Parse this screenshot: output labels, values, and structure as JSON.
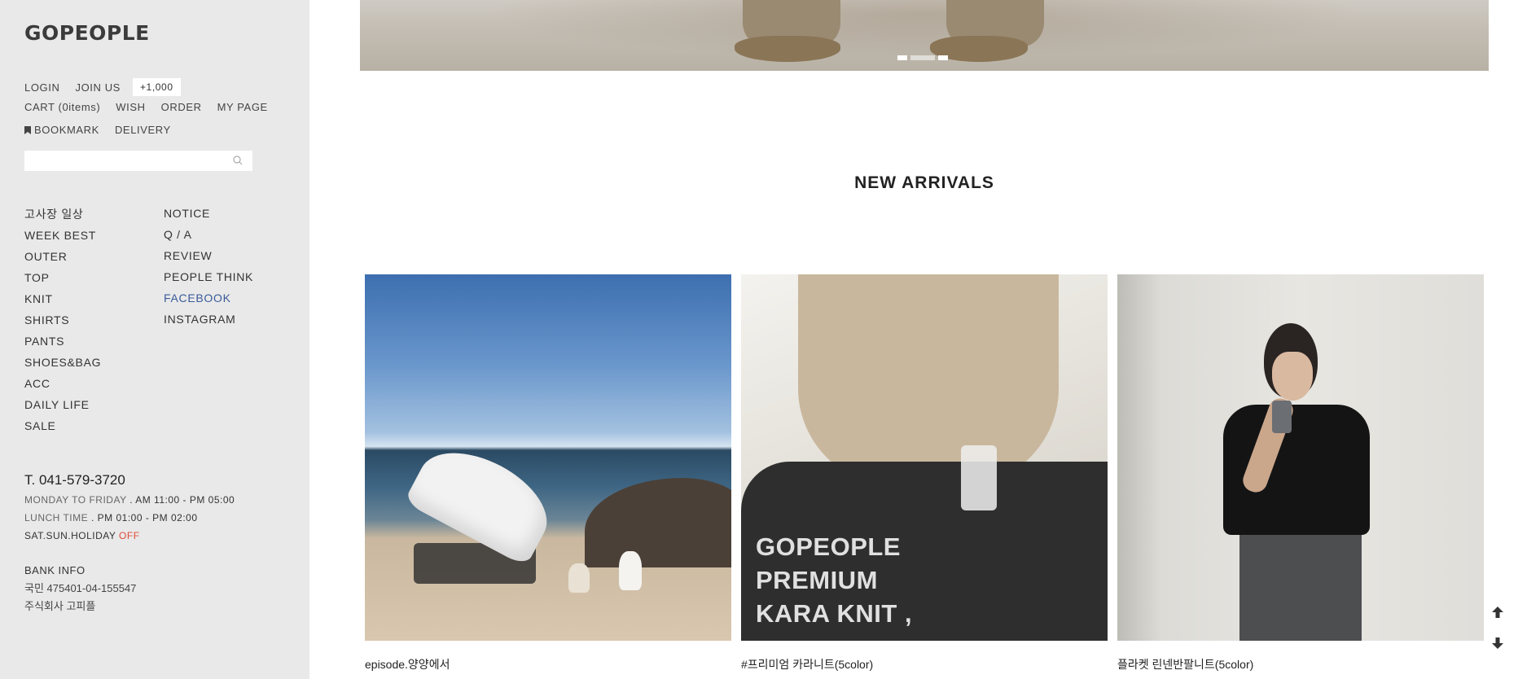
{
  "brand": {
    "logo": "GOPEOPLE"
  },
  "utility": {
    "row1": [
      "LOGIN",
      "JOIN US"
    ],
    "join_badge": "+1,000",
    "row2": [
      "CART (0items)",
      "WISH",
      "ORDER",
      "MY PAGE"
    ],
    "bookmark": "BOOKMARK",
    "delivery": "DELIVERY"
  },
  "search": {
    "placeholder": "",
    "icon": "search-icon"
  },
  "categories": [
    "고사장 일상",
    "WEEK BEST",
    "OUTER",
    "TOP",
    "KNIT",
    "SHIRTS",
    "PANTS",
    "SHOES&BAG",
    "ACC",
    "DAILY LIFE",
    "SALE"
  ],
  "boards": [
    "NOTICE",
    "Q / A",
    "REVIEW",
    "PEOPLE THINK",
    "FACEBOOK",
    "INSTAGRAM"
  ],
  "cs": {
    "tel": "T. 041-579-3720",
    "weekday_label": "MONDAY TO FRIDAY",
    "weekday_hours": ". AM 11:00 - PM 05:00",
    "lunch_label": "LUNCH TIME",
    "lunch_hours": ". PM 01:00 - PM 02:00",
    "holiday_label": "SAT.SUN.HOLIDAY",
    "holiday_status": "OFF"
  },
  "bank": {
    "title": "BANK INFO",
    "account": "국민 475401-04-155547",
    "holder": "주식회사 고피플"
  },
  "hero": {
    "slide_count": 3,
    "active_slide": 1
  },
  "main": {
    "section_title": "NEW ARRIVALS",
    "products": [
      {
        "name": "episode.양양에서"
      },
      {
        "name": "#프리미엄 카라니트(5color)",
        "overlay": [
          "GOPEOPLE",
          "PREMIUM",
          "KARA KNIT ,"
        ]
      },
      {
        "name": "플라켓 린넨반팔니트(5color)"
      }
    ]
  },
  "float_buttons": {
    "up": "arrow-up-icon",
    "down": "arrow-down-icon"
  },
  "colors": {
    "sidebar_bg": "#e9e9e9",
    "facebook_link": "#3a5a9a",
    "off_text": "#e04a3a"
  }
}
